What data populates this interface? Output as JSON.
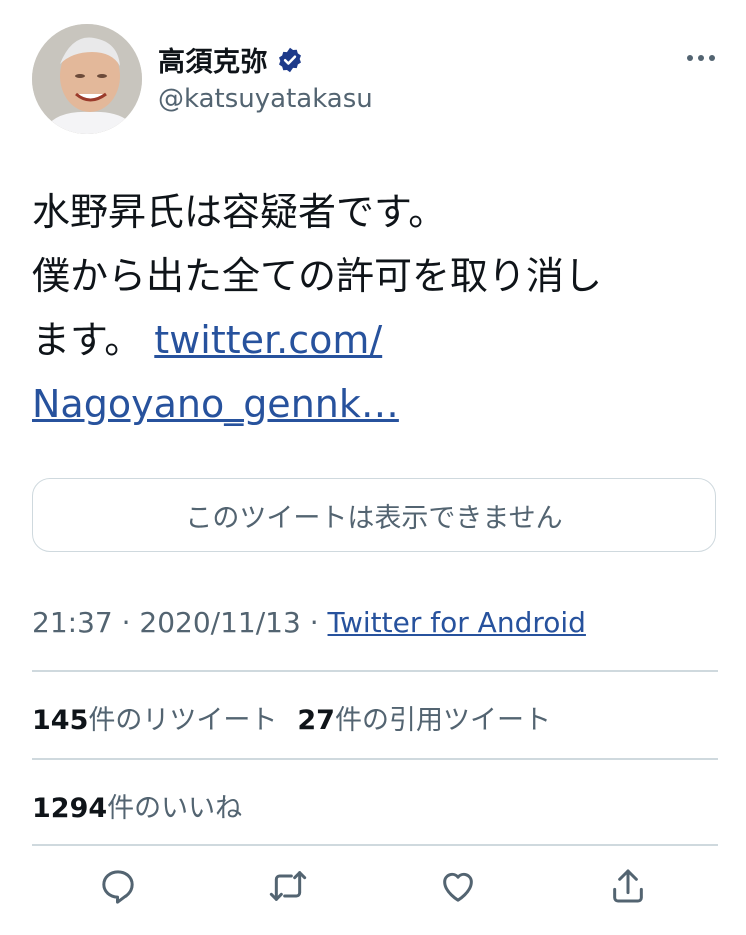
{
  "user": {
    "display_name": "高須克弥",
    "handle": "@katsuyatakasu",
    "verified": true,
    "avatar_icon": "profile-photo"
  },
  "tweet": {
    "line1": "水野昇氏は容疑者です。",
    "line2": "僕から出た全ての許可を取り消し",
    "line3_text": "ます。",
    "link_part1": "twitter.com/",
    "link_part2": "Nagoyano_gennk…",
    "quoted_unavailable": "このツイートは表示できません"
  },
  "meta": {
    "time": "21:37",
    "separator": "·",
    "date": "2020/11/13",
    "separator2": "·",
    "source": "Twitter for Android"
  },
  "stats": {
    "retweets_count": "145",
    "retweets_label": "件のリツイート",
    "quotes_count": "27",
    "quotes_label": "件の引用ツイート",
    "likes_count": "1294",
    "likes_label": "件のいいね"
  },
  "actions": [
    "reply-icon",
    "retweet-icon",
    "like-icon",
    "share-icon"
  ],
  "colors": {
    "text": "#0f1419",
    "secondary": "#536471",
    "link": "#27529d",
    "border": "#cfd9de",
    "verified": "#1d3a8a"
  }
}
